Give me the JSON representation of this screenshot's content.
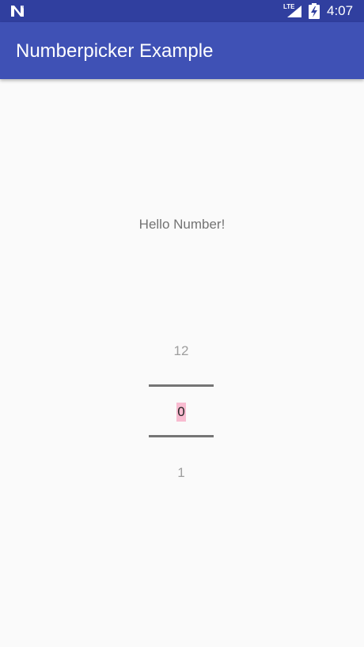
{
  "status_bar": {
    "network_label": "LTE",
    "time": "4:07",
    "background_color": "#303f9f",
    "icons": [
      "n-logo-icon",
      "signal-icon",
      "battery-charging-icon"
    ]
  },
  "app_bar": {
    "title": "Numberpicker Example",
    "background_color": "#3f51b5"
  },
  "main": {
    "greeting": "Hello Number!"
  },
  "number_picker": {
    "previous_value": "12",
    "current_value": "0",
    "next_value": "1",
    "highlight_color": "#f8bbd0"
  }
}
